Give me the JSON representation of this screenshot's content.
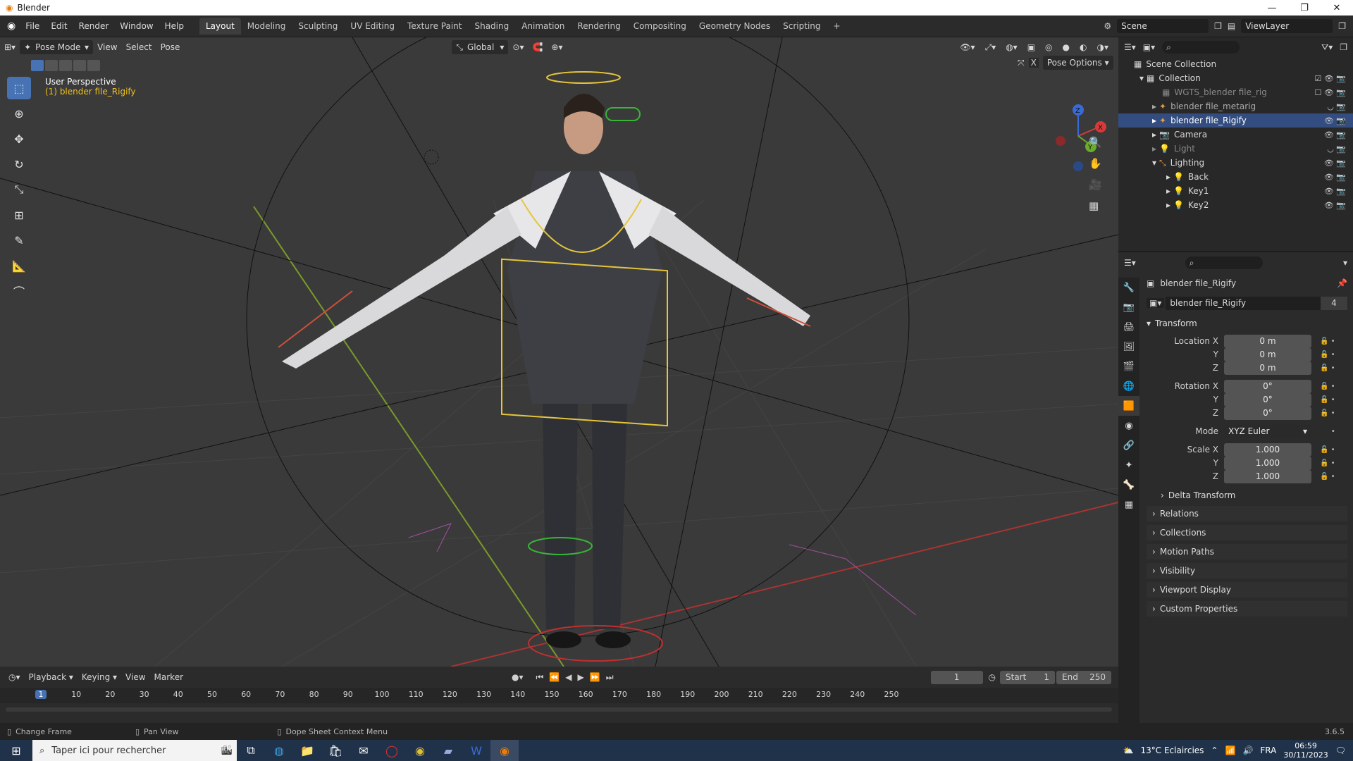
{
  "window": {
    "title": "Blender"
  },
  "menu": [
    "File",
    "Edit",
    "Render",
    "Window",
    "Help"
  ],
  "workspaces": [
    "Layout",
    "Modeling",
    "Sculpting",
    "UV Editing",
    "Texture Paint",
    "Shading",
    "Animation",
    "Rendering",
    "Compositing",
    "Geometry Nodes",
    "Scripting",
    "+"
  ],
  "scene": "Scene",
  "view_layer": "ViewLayer",
  "viewport": {
    "mode": "Pose Mode",
    "menus": [
      "View",
      "Select",
      "Pose"
    ],
    "orientation": "Global",
    "pose_options": "Pose Options",
    "info_line1": "User Perspective",
    "info_line2": "(1) blender file_Rigify"
  },
  "outliner": {
    "rows": [
      {
        "label": "Scene Collection",
        "indent": 0
      },
      {
        "label": "Collection",
        "indent": 1
      },
      {
        "label": "WGTS_blender file_rig",
        "indent": 2
      },
      {
        "label": "blender file_metarig",
        "indent": 2
      },
      {
        "label": "blender file_Rigify",
        "indent": 2
      },
      {
        "label": "Camera",
        "indent": 2
      },
      {
        "label": "Light",
        "indent": 2
      },
      {
        "label": "Lighting",
        "indent": 2
      },
      {
        "label": "Back",
        "indent": 3
      },
      {
        "label": "Key1",
        "indent": 3
      },
      {
        "label": "Key2",
        "indent": 3
      }
    ]
  },
  "properties": {
    "object_name": "blender file_Rigify",
    "data_name": "blender file_Rigify",
    "users": "4",
    "transform_label": "Transform",
    "location": {
      "label": "Location X",
      "x": "0 m",
      "y": "0 m",
      "z": "0 m"
    },
    "rotation": {
      "label": "Rotation X",
      "x": "0°",
      "y": "0°",
      "z": "0°"
    },
    "mode_label": "Mode",
    "mode_value": "XYZ Euler",
    "scale": {
      "label": "Scale X",
      "x": "1.000",
      "y": "1.000",
      "z": "1.000"
    },
    "axis_y": "Y",
    "axis_z": "Z",
    "panels": [
      "Delta Transform",
      "Relations",
      "Collections",
      "Motion Paths",
      "Visibility",
      "Viewport Display",
      "Custom Properties"
    ]
  },
  "timeline": {
    "menus": [
      "Playback",
      "Keying",
      "View",
      "Marker"
    ],
    "current_frame": "1",
    "start_label": "Start",
    "start": "1",
    "end_label": "End",
    "end": "250",
    "ticks": [
      "1",
      "10",
      "20",
      "30",
      "40",
      "50",
      "60",
      "70",
      "80",
      "90",
      "100",
      "110",
      "120",
      "130",
      "140",
      "150",
      "160",
      "170",
      "180",
      "190",
      "200",
      "210",
      "220",
      "230",
      "240",
      "250"
    ]
  },
  "statusbar": {
    "hint1": "Change Frame",
    "hint2": "Pan View",
    "hint3": "Dope Sheet Context Menu",
    "version": "3.6.5"
  },
  "taskbar": {
    "search_placeholder": "Taper ici pour rechercher",
    "weather": "13°C  Eclaircies",
    "lang": "FRA",
    "time": "06:59",
    "date": "30/11/2023"
  }
}
